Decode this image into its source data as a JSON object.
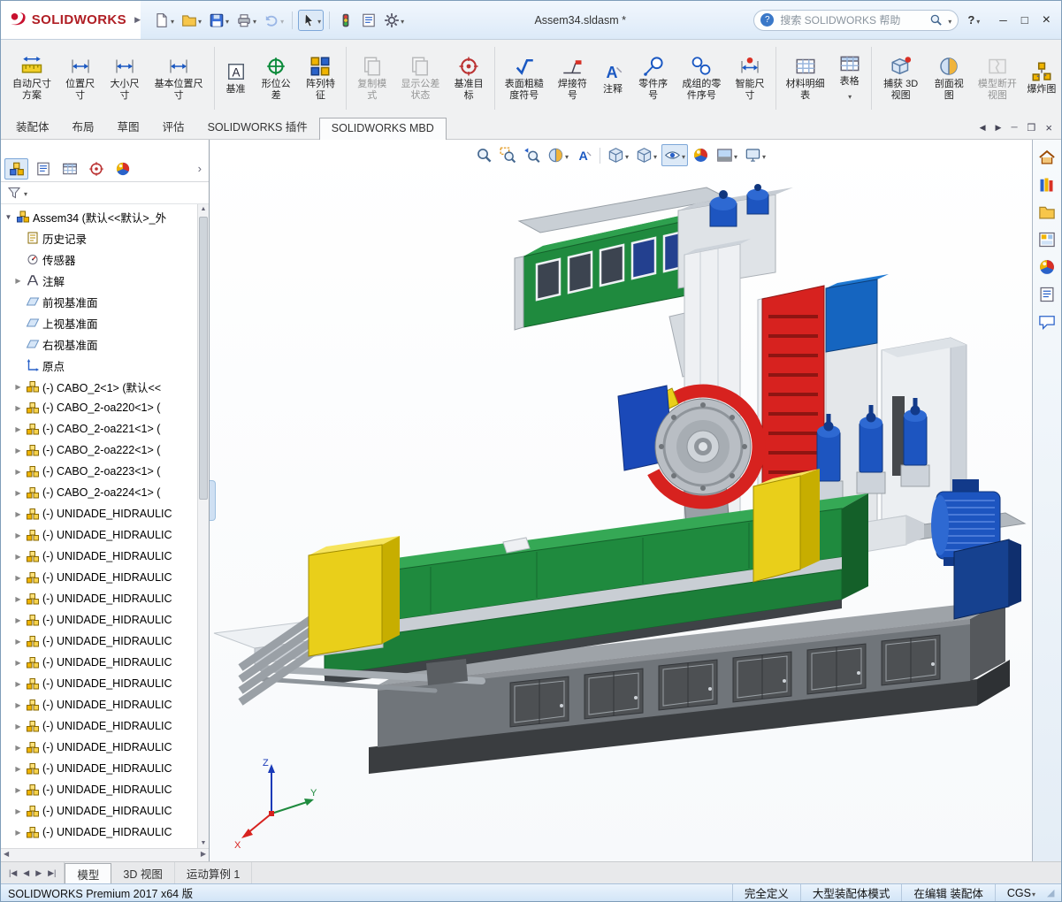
{
  "titlebar": {
    "logo_text": "SOLIDWORKS",
    "doc_title": "Assem34.sldasm *",
    "search_placeholder": "搜索 SOLIDWORKS 帮助",
    "help_label": "?"
  },
  "ribbon": {
    "buttons": [
      {
        "label": "自动尺寸方案",
        "enabled": true
      },
      {
        "label": "位置尺寸",
        "enabled": true
      },
      {
        "label": "大小尺寸",
        "enabled": true
      },
      {
        "label": "基本位置尺寸",
        "enabled": true
      },
      {
        "label": "基准",
        "enabled": true
      },
      {
        "label": "形位公差",
        "enabled": true
      },
      {
        "label": "阵列特征",
        "enabled": true
      },
      {
        "label": "复制模式",
        "enabled": false
      },
      {
        "label": "显示公差状态",
        "enabled": false
      },
      {
        "label": "基准目标",
        "enabled": true
      },
      {
        "label": "表面粗糙度符号",
        "enabled": true
      },
      {
        "label": "焊接符号",
        "enabled": true
      },
      {
        "label": "注释",
        "enabled": true
      },
      {
        "label": "零件序号",
        "enabled": true
      },
      {
        "label": "成组的零件序号",
        "enabled": true
      },
      {
        "label": "智能尺寸",
        "enabled": true
      },
      {
        "label": "材料明细表",
        "enabled": true
      },
      {
        "label": "表格",
        "enabled": true,
        "dropdown": true
      },
      {
        "label": "捕获 3D 视图",
        "enabled": true
      },
      {
        "label": "剖面视图",
        "enabled": true
      },
      {
        "label": "模型断开视图",
        "enabled": false
      },
      {
        "label": "爆炸图",
        "enabled": true
      }
    ]
  },
  "command_tabs": {
    "items": [
      "装配体",
      "布局",
      "草图",
      "评估",
      "SOLIDWORKS 插件",
      "SOLIDWORKS MBD"
    ],
    "active_index": 5
  },
  "feature_tree": {
    "root_label": "Assem34 (默认<<默认>_外",
    "items": [
      {
        "label": "历史记录"
      },
      {
        "label": "传感器"
      },
      {
        "label": "注解"
      },
      {
        "label": "前视基准面"
      },
      {
        "label": "上视基准面"
      },
      {
        "label": "右视基准面"
      },
      {
        "label": "原点"
      },
      {
        "label": "(-) CABO_2<1> (默认<<"
      },
      {
        "label": "(-) CABO_2-oa220<1> ("
      },
      {
        "label": "(-) CABO_2-oa221<1> ("
      },
      {
        "label": "(-) CABO_2-oa222<1> ("
      },
      {
        "label": "(-) CABO_2-oa223<1> ("
      },
      {
        "label": "(-) CABO_2-oa224<1> ("
      },
      {
        "label": "(-) UNIDADE_HIDRAULIC"
      },
      {
        "label": "(-) UNIDADE_HIDRAULIC"
      },
      {
        "label": "(-) UNIDADE_HIDRAULIC"
      },
      {
        "label": "(-) UNIDADE_HIDRAULIC"
      },
      {
        "label": "(-) UNIDADE_HIDRAULIC"
      },
      {
        "label": "(-) UNIDADE_HIDRAULIC"
      },
      {
        "label": "(-) UNIDADE_HIDRAULIC"
      },
      {
        "label": "(-) UNIDADE_HIDRAULIC"
      },
      {
        "label": "(-) UNIDADE_HIDRAULIC"
      },
      {
        "label": "(-) UNIDADE_HIDRAULIC"
      },
      {
        "label": "(-) UNIDADE_HIDRAULIC"
      },
      {
        "label": "(-) UNIDADE_HIDRAULIC"
      },
      {
        "label": "(-) UNIDADE_HIDRAULIC"
      },
      {
        "label": "(-) UNIDADE_HIDRAULIC"
      },
      {
        "label": "(-) UNIDADE_HIDRAULIC"
      },
      {
        "label": "(-) UNIDADE_HIDRAULIC"
      }
    ]
  },
  "viewport": {
    "triad": {
      "x": "X",
      "y": "Y",
      "z": "Z"
    }
  },
  "bottom_tabs": {
    "items": [
      "模型",
      "3D 视图",
      "运动算例 1"
    ],
    "active_index": 0
  },
  "status_bar": {
    "left": "SOLIDWORKS Premium 2017 x64 版",
    "items": [
      "完全定义",
      "大型装配体模式",
      "在编辑 装配体"
    ],
    "unit": "CGS"
  }
}
